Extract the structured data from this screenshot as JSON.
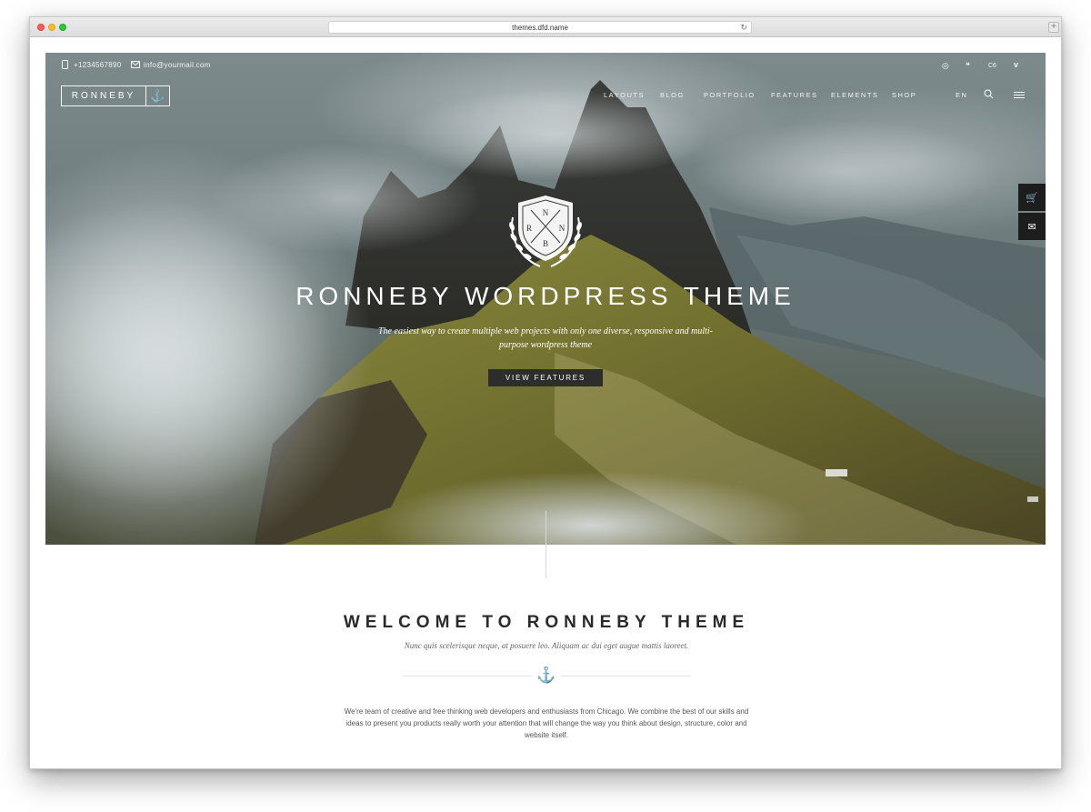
{
  "browser": {
    "url": "themes.dfd.name",
    "reload_glyph": "↻",
    "new_tab_glyph": "+"
  },
  "topbar": {
    "phone": "+1234567890",
    "email": "info@yourmail.com",
    "social_icons": [
      "dribbble-icon",
      "chat-icon",
      "cs-icon",
      "vimeo-icon"
    ],
    "social_glyphs": [
      "◎",
      "❝",
      "C6",
      "v"
    ]
  },
  "logo": {
    "text": "RONNEBY",
    "icon": "anchor-icon",
    "glyph": "⚓"
  },
  "nav": {
    "items": [
      "LAYOUTS",
      "BLOG",
      "PORTFOLIO",
      "FEATURES",
      "ELEMENTS",
      "SHOP"
    ],
    "language": "EN"
  },
  "side_buttons": {
    "cart_glyph": "🛒",
    "mail_glyph": "✉"
  },
  "hero": {
    "crest_letters": [
      "R",
      "N",
      "N",
      "B"
    ],
    "title": "RONNEBY WORDPRESS THEME",
    "subtitle": "The easiest way to create multiple web projects with only one diverse, responsive and multi-purpose wordpress theme",
    "button": "VIEW FEATURES"
  },
  "welcome": {
    "title": "WELCOME TO RONNEBY THEME",
    "subtitle": "Nunc quis scelerisque neque, at posuere leo. Aliquam ac dui eget augue mattis laoreet.",
    "anchor_glyph": "⚓",
    "body": "We're team of creative and free thinking web developers and enthusiasts from Chicago. We combine the best of our skills and ideas to present you products really worth your attention that will change the way you think about design, structure, color and website itself."
  },
  "colors": {
    "accent": "#7b7d4a",
    "dark": "#2d2d2d",
    "side_button": "#1d1d1d"
  }
}
